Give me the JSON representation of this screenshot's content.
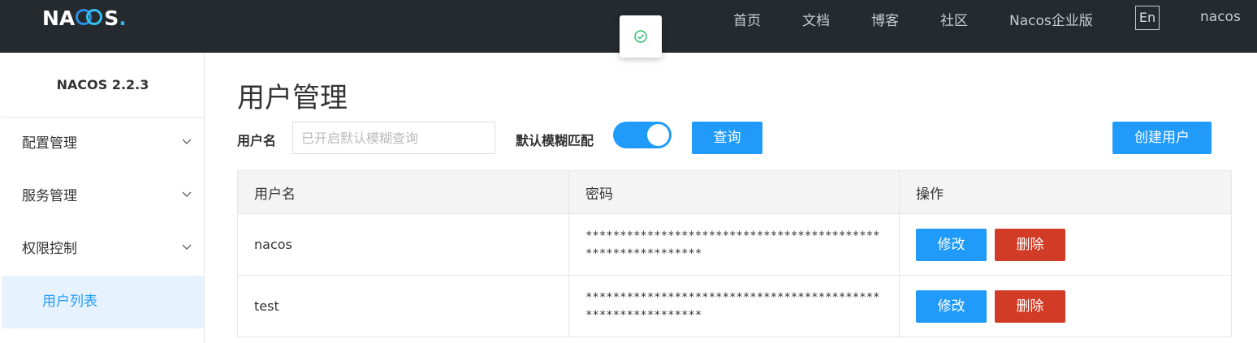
{
  "header": {
    "logo": {
      "pre": "NA",
      "post": "S",
      "dot": "."
    },
    "nav": [
      "首页",
      "文档",
      "博客",
      "社区",
      "Nacos企业版"
    ],
    "lang": "En",
    "user": "nacos",
    "brand_color": "#252a2f"
  },
  "toast": {
    "icon": "check-circle-icon"
  },
  "sidebar": {
    "version": "NACOS 2.2.3",
    "items": [
      {
        "label": "配置管理"
      },
      {
        "label": "服务管理"
      },
      {
        "label": "权限控制"
      }
    ],
    "active_sub": "用户列表"
  },
  "main": {
    "title": "用户管理",
    "search": {
      "label": "用户名",
      "placeholder": "已开启默认模糊查询",
      "value": "",
      "fuzzy_label": "默认模糊匹配",
      "fuzzy_on": true,
      "search_button": "查询",
      "create_button": "创建用户"
    },
    "table": {
      "columns": [
        "用户名",
        "密码",
        "操作"
      ],
      "rows": [
        {
          "username": "nacos",
          "password": "************************************************************",
          "edit": "修改",
          "delete": "删除"
        },
        {
          "username": "test",
          "password": "************************************************************",
          "edit": "修改",
          "delete": "删除"
        }
      ]
    }
  },
  "colors": {
    "accent": "#209bfa",
    "danger": "#d23c26"
  }
}
